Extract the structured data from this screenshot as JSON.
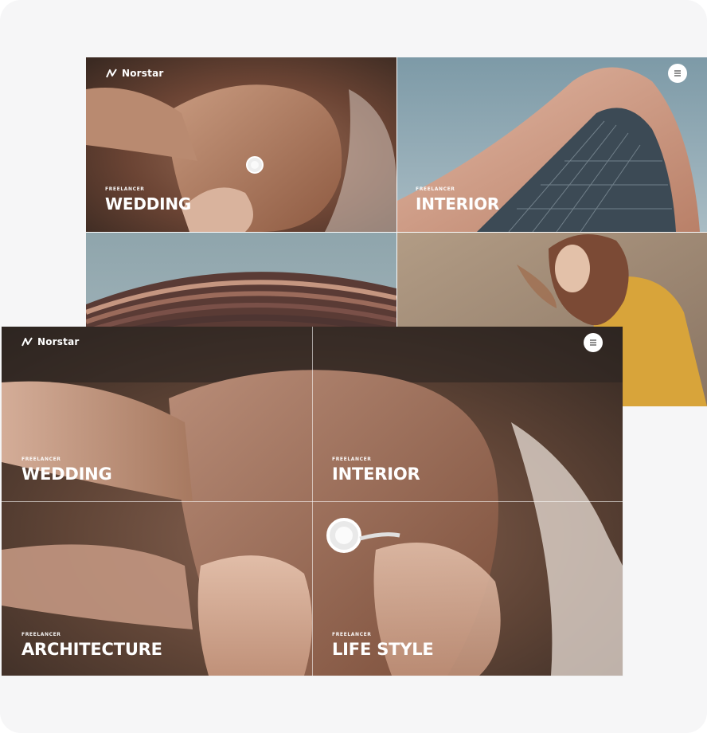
{
  "back_screen": {
    "brand": "Norstar",
    "menu_icon": "hamburger-menu-icon",
    "tiles": [
      {
        "eyebrow": "FREELANCER",
        "title": "WEDDING"
      },
      {
        "eyebrow": "FREELANCER",
        "title": "INTERIOR"
      }
    ]
  },
  "front_screen": {
    "brand": "Norstar",
    "menu_icon": "hamburger-menu-icon",
    "tiles": [
      {
        "eyebrow": "FREELANCER",
        "title": "WEDDING"
      },
      {
        "eyebrow": "FREELANCER",
        "title": "INTERIOR"
      },
      {
        "eyebrow": "FREELANCER",
        "title": "ARCHITECTURE"
      },
      {
        "eyebrow": "FREELANCER",
        "title": "LIFE STYLE"
      }
    ]
  },
  "colors": {
    "page_background": "#f6f6f7",
    "text_on_image": "#ffffff",
    "menu_button": "#ffffff"
  }
}
